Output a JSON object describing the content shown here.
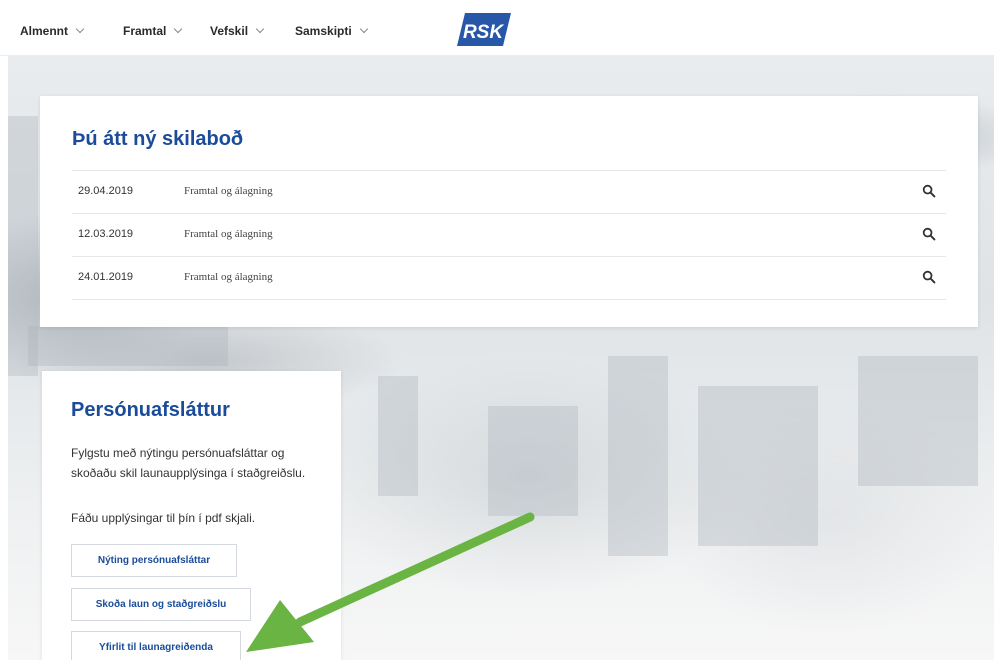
{
  "nav": {
    "items": [
      {
        "label": "Almennt"
      },
      {
        "label": "Framtal"
      },
      {
        "label": "Vefskil"
      },
      {
        "label": "Samskipti"
      }
    ],
    "logo_text": "RSK"
  },
  "messages": {
    "title": "Þú átt ný skilaboð",
    "rows": [
      {
        "date": "29.04.2019",
        "subject": "Framtal og álagning"
      },
      {
        "date": "12.03.2019",
        "subject": "Framtal og álagning"
      },
      {
        "date": "24.01.2019",
        "subject": "Framtal og álagning"
      }
    ],
    "row_icon": "search-icon"
  },
  "personuafslattur": {
    "title": "Persónuafsláttur",
    "description": "Fylgstu með nýtingu persónuafsláttar og skoðaðu skil launaupplýsinga í staðgreiðslu.",
    "description2": "Fáðu upplýsingar til þín í pdf skjali.",
    "buttons": [
      {
        "label": "Nýting persónuafsláttar"
      },
      {
        "label": "Skoða laun og staðgreiðslu"
      },
      {
        "label": "Yfirlit til launagreiðenda"
      }
    ]
  },
  "colors": {
    "brand_blue": "#1b4c9a",
    "logo_blue": "#2857a8",
    "arrow_green": "#6ab443"
  }
}
